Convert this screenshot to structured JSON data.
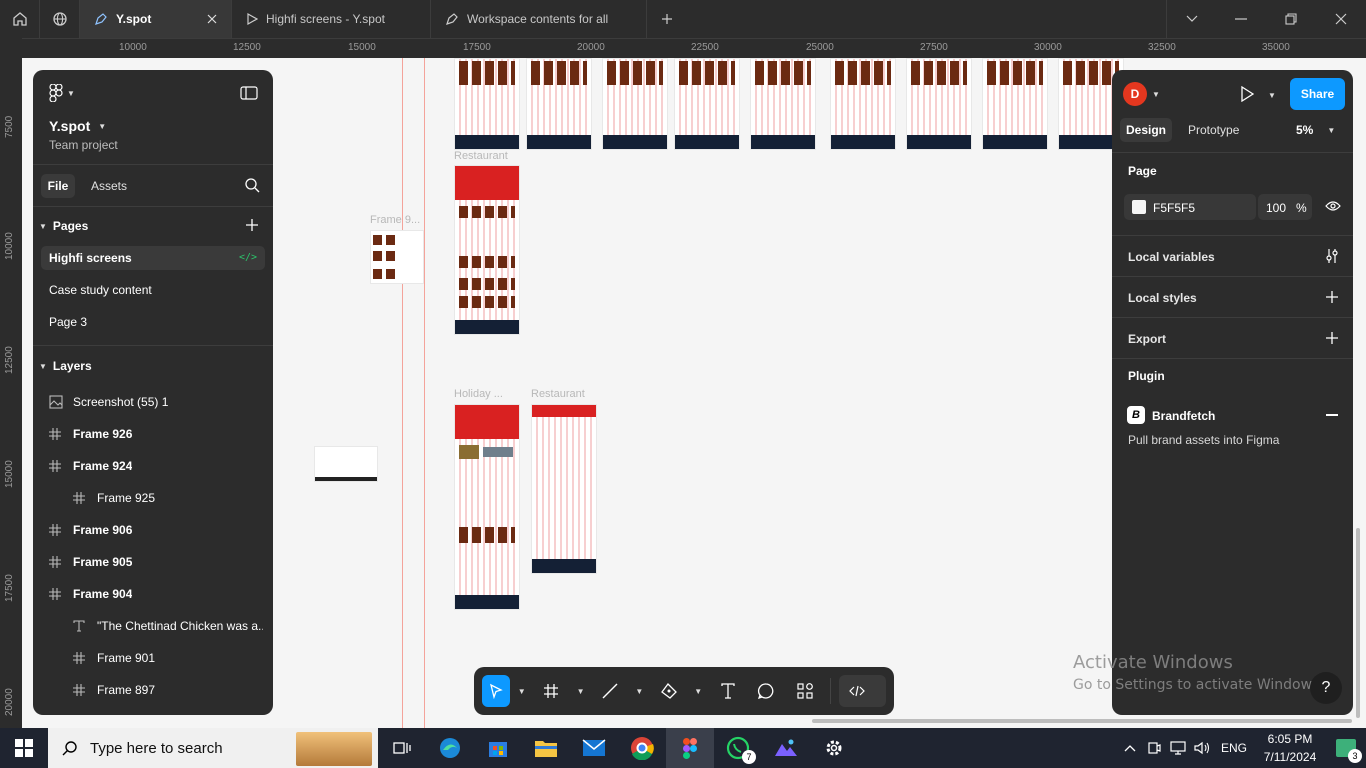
{
  "titlebar": {
    "tabs": [
      {
        "label": "Y.spot",
        "active": true
      },
      {
        "label": "Highfi screens - Y.spot",
        "active": false
      },
      {
        "label": "Workspace contents for all",
        "active": false
      }
    ]
  },
  "rulers": {
    "horizontal": [
      "10000",
      "12500",
      "15000",
      "17500",
      "20000",
      "22500",
      "25000",
      "27500",
      "30000",
      "32500",
      "35000"
    ],
    "vertical": [
      "7500",
      "10000",
      "12500",
      "15000",
      "17500",
      "20000"
    ]
  },
  "canvas": {
    "frame_labels": [
      "Restaurant",
      "Frame 9...",
      "Holiday ...",
      "Restaurant"
    ]
  },
  "left_panel": {
    "file_name": "Y.spot",
    "project_type": "Team project",
    "tabs": {
      "file": "File",
      "assets": "Assets"
    },
    "pages_title": "Pages",
    "pages": [
      "Highfi screens",
      "Case study content",
      "Page 3"
    ],
    "layers_title": "Layers",
    "layers": [
      {
        "name": "Screenshot (55) 1",
        "icon": "image-icon",
        "indent": 0,
        "bold": false
      },
      {
        "name": "Frame 926",
        "icon": "frame-icon",
        "indent": 0,
        "bold": true
      },
      {
        "name": "Frame 924",
        "icon": "frame-icon",
        "indent": 0,
        "bold": true
      },
      {
        "name": "Frame 925",
        "icon": "frame-icon",
        "indent": 1,
        "bold": false
      },
      {
        "name": "Frame 906",
        "icon": "frame-icon",
        "indent": 0,
        "bold": true
      },
      {
        "name": "Frame 905",
        "icon": "frame-icon",
        "indent": 0,
        "bold": true
      },
      {
        "name": "Frame 904",
        "icon": "frame-icon",
        "indent": 0,
        "bold": true
      },
      {
        "name": "\"The Chettinad Chicken was a...",
        "icon": "text-icon",
        "indent": 1,
        "bold": false
      },
      {
        "name": "Frame 901",
        "icon": "frame-icon",
        "indent": 1,
        "bold": false
      },
      {
        "name": "Frame 897",
        "icon": "frame-icon",
        "indent": 1,
        "bold": false
      }
    ]
  },
  "right_panel": {
    "avatar_letter": "D",
    "avatar_color": "#e4371f",
    "share_label": "Share",
    "share_color": "#0d99ff",
    "tabs": {
      "design": "Design",
      "prototype": "Prototype"
    },
    "zoom": "5%",
    "page_section": "Page",
    "page_color_hex": "F5F5F5",
    "page_opacity": "100",
    "percent_sign": "%",
    "local_variables": "Local variables",
    "local_styles": "Local styles",
    "export": "Export",
    "plugin": "Plugin",
    "plugin_name": "Brandfetch",
    "plugin_desc": "Pull brand assets into Figma"
  },
  "watermark": {
    "title": "Activate Windows",
    "subtitle": "Go to Settings to activate Windows."
  },
  "help_label": "?",
  "taskbar": {
    "search_placeholder": "Type here to search",
    "language": "ENG",
    "time": "6:05 PM",
    "date": "7/11/2024",
    "whatsapp_badge": "7",
    "notification_count": "3"
  }
}
